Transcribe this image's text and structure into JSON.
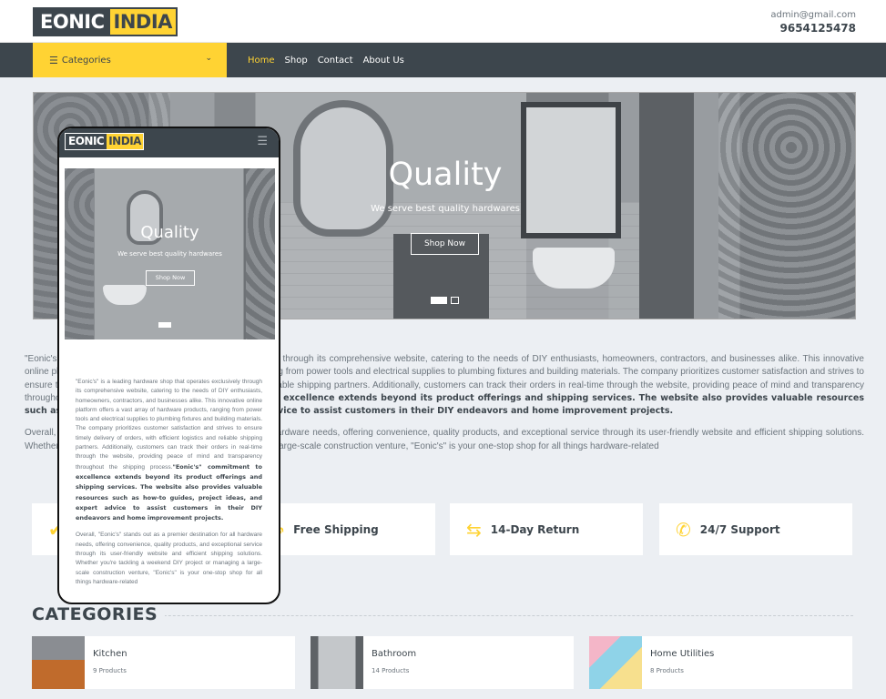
{
  "header": {
    "logo_part1": "EONIC",
    "logo_part2": "INDIA",
    "email": "admin@gmail.com",
    "phone": "9654125478"
  },
  "navbar": {
    "categories_label": "Categories",
    "links": [
      "Home",
      "Shop",
      "Contact",
      "About Us"
    ],
    "active_link": "Home"
  },
  "carousel": {
    "title": "Quality",
    "subtitle": "We serve best quality hardwares",
    "button": "Shop Now"
  },
  "about": {
    "para1_start": "\"Eonic's\" is a leading hardware shop that operates exclusively through its comprehensive website, catering to the needs of DIY enthusiasts, homeowners, contractors, and businesses alike. This innovative online platform offers a vast array of hardware products, ranging from power tools and electrical supplies to plumbing fixtures and building materials. The company prioritizes customer satisfaction and strives to ensure timely delivery of orders, with efficient logistics and reliable shipping partners. Additionally, customers can track their orders in real-time through the website, providing peace of mind and transparency throughout the shipping process.",
    "para1_bold": "\"Eonic's\" commitment to excellence extends beyond its product offerings and shipping services. The website also provides valuable resources such as how-to guides, project ideas, and expert advice to assist customers in their DIY endeavors and home improvement projects.",
    "para2": "Overall, \"Eonic's\" stands out as a premier destination for all hardware needs, offering convenience, quality products, and exceptional service through its user-friendly website and efficient shipping solutions. Whether you're tackling a weekend DIY project or managing a large-scale construction venture, \"Eonic's\" is your one-stop shop for all things hardware-related"
  },
  "features": [
    {
      "label": "Free Shipping",
      "icon": "truck-icon"
    },
    {
      "label": "14-Day Return",
      "icon": "exchange-icon"
    },
    {
      "label": "24/7 Support",
      "icon": "phone-icon"
    }
  ],
  "categories": {
    "heading": "CATEGORIES",
    "items": [
      {
        "name": "Kitchen",
        "count": "9 Products"
      },
      {
        "name": "Bathroom",
        "count": "14 Products"
      },
      {
        "name": "Home Utilities",
        "count": "8 Products"
      }
    ]
  },
  "colors": {
    "accent": "#ffd333",
    "dark": "#3d464d",
    "background": "#eceff3"
  }
}
